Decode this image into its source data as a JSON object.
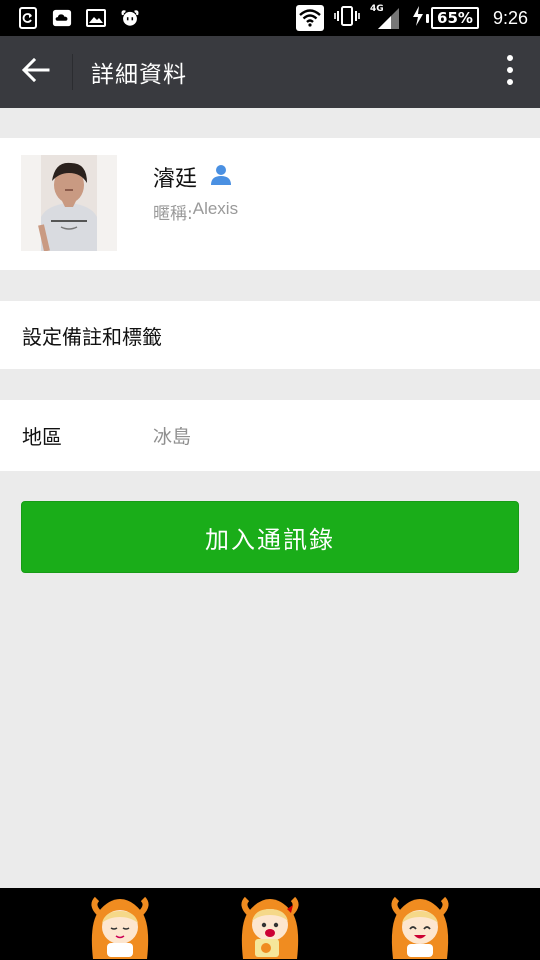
{
  "status_bar": {
    "battery": "65%",
    "network": "4G",
    "time": "9:26",
    "notification_icons": [
      "sync-icon",
      "cloud-icon",
      "image-icon",
      "anime-app-icon"
    ]
  },
  "app_bar": {
    "title": "詳細資料",
    "background_color": "#393a3f"
  },
  "profile": {
    "name": "濬廷",
    "nickname_label": "暱稱: ",
    "nickname": "Alexis"
  },
  "remark": {
    "label": "設定備註和標籤"
  },
  "region": {
    "label": "地區",
    "value": "冰島"
  },
  "actions": {
    "add_contact_label": "加入通訊錄",
    "accent_color": "#1aad19"
  },
  "nav_bar": {
    "buttons": [
      "back-mascot-icon",
      "home-mascot-icon",
      "recents-mascot-icon"
    ]
  }
}
